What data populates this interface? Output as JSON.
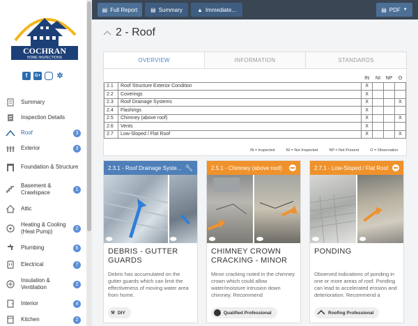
{
  "brand": {
    "name": "COCHRAN",
    "tagline": "HOME INSPECTIONS"
  },
  "socials": [
    "f",
    "G+",
    "ig",
    "yelp"
  ],
  "sidebar": {
    "items": [
      {
        "label": "Summary",
        "icon": "document-icon",
        "badge": ""
      },
      {
        "label": "Inspection Details",
        "icon": "clipboard-icon",
        "badge": ""
      },
      {
        "label": "Roof",
        "icon": "roof-icon",
        "badge": "3",
        "active": true
      },
      {
        "label": "Exterior",
        "icon": "fence-icon",
        "badge": "3"
      },
      {
        "label": "Foundation & Structure",
        "icon": "foundation-icon",
        "badge": ""
      },
      {
        "label": "Basement & Crawlspace",
        "icon": "stairs-icon",
        "badge": "1"
      },
      {
        "label": "Attic",
        "icon": "house-icon",
        "badge": ""
      },
      {
        "label": "Heating & Cooling (Heat Pump)",
        "icon": "fan-icon",
        "badge": "2"
      },
      {
        "label": "Plumbing",
        "icon": "faucet-icon",
        "badge": "6"
      },
      {
        "label": "Electrical",
        "icon": "outlet-icon",
        "badge": "7"
      },
      {
        "label": "Insulation & Ventilation",
        "icon": "vent-icon",
        "badge": "2"
      },
      {
        "label": "Interior",
        "icon": "door-icon",
        "badge": "4"
      },
      {
        "label": "Kitchen",
        "icon": "stove-icon",
        "badge": "2"
      }
    ]
  },
  "topbar": {
    "full_report": "Full Report",
    "summary": "Summary",
    "immediate": "Immediate...",
    "pdf": "PDF"
  },
  "section": {
    "title": "2 - Roof"
  },
  "tabs": [
    "OVERVIEW",
    "INFORMATION",
    "STANDARDS"
  ],
  "table": {
    "headers": [
      "IN",
      "NI",
      "NP",
      "O"
    ],
    "rows": [
      {
        "num": "2.1",
        "name": "Roof Structure Exterior Condition",
        "marks": [
          "X",
          "",
          "",
          ""
        ]
      },
      {
        "num": "2.2",
        "name": "Coverings",
        "marks": [
          "X",
          "",
          "",
          ""
        ]
      },
      {
        "num": "2.3",
        "name": "Roof Drainage Systems",
        "marks": [
          "X",
          "",
          "",
          "X"
        ]
      },
      {
        "num": "2.4",
        "name": "Flashings",
        "marks": [
          "X",
          "",
          "",
          ""
        ]
      },
      {
        "num": "2.5",
        "name": "Chimney (above roof)",
        "marks": [
          "X",
          "",
          "",
          "X"
        ]
      },
      {
        "num": "2.6",
        "name": "Vents",
        "marks": [
          "X",
          "",
          "",
          ""
        ]
      },
      {
        "num": "2.7",
        "name": "Low-Sloped / Flat Roof",
        "marks": [
          "X",
          "",
          "",
          "X"
        ]
      }
    ],
    "legend": [
      "IN = Inspected",
      "NI = Not Inspected",
      "NP = Not Present",
      "O = Observation"
    ]
  },
  "cards": [
    {
      "header": "2.3.1 - Roof Drainage Syste...",
      "color": "#4f7fb8",
      "title": "DEBRIS - GUTTER GUARDS",
      "desc": "Debris has accumulated on the gutter guards which can limit the effectiveness of moving water area from home.",
      "pill": "DIY"
    },
    {
      "header": "2.5.1 - Chimney (above roof)",
      "color": "#f0922b",
      "title": "CHIMNEY CROWN CRACKING - MINOR",
      "desc": "Minor cracking noted in the chimney crown which could allow water/moisture intrusion down chimney. Recommend",
      "pill": "Qualified Professional"
    },
    {
      "header": "2.7.1 - Low-Sloped / Flat Roof",
      "color": "#f0922b",
      "title": "PONDING",
      "desc": "Observed indications of ponding in one or more areas of roof. Ponding can lead to accelerated erosion and deterioration. Recommend a",
      "pill": "Roofing Professional"
    }
  ]
}
